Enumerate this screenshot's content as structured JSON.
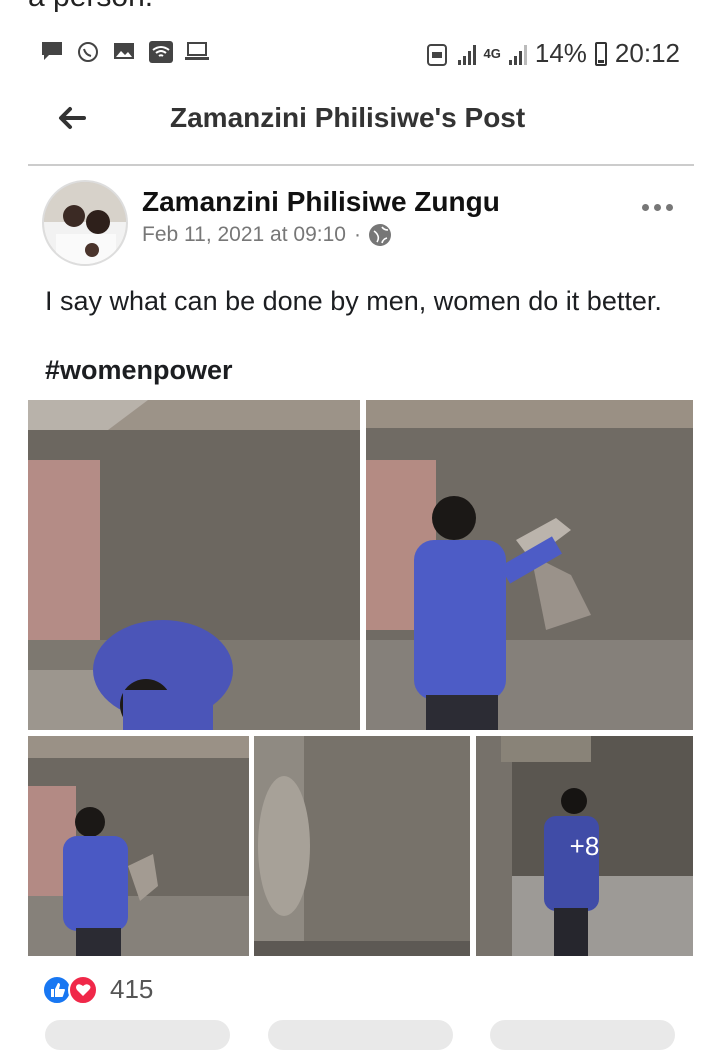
{
  "cut_text": "a person.",
  "status": {
    "battery": "14%",
    "time": "20:12",
    "network": "4G"
  },
  "header": {
    "title": "Zamanzini Philisiwe's Post"
  },
  "post": {
    "author": "Zamanzini Philisiwe Zungu",
    "timestamp": "Feb 11, 2021 at 09:10",
    "separator": "·",
    "text": "I say what can be done by men, women do it better.",
    "hashtag": "#womenpower",
    "more_photos": "+8",
    "reactions_count": "415"
  },
  "colors": {
    "like": "#1877f2",
    "love": "#f02849",
    "wall": "#6f6a63",
    "shirt": "#4a5bc8"
  }
}
